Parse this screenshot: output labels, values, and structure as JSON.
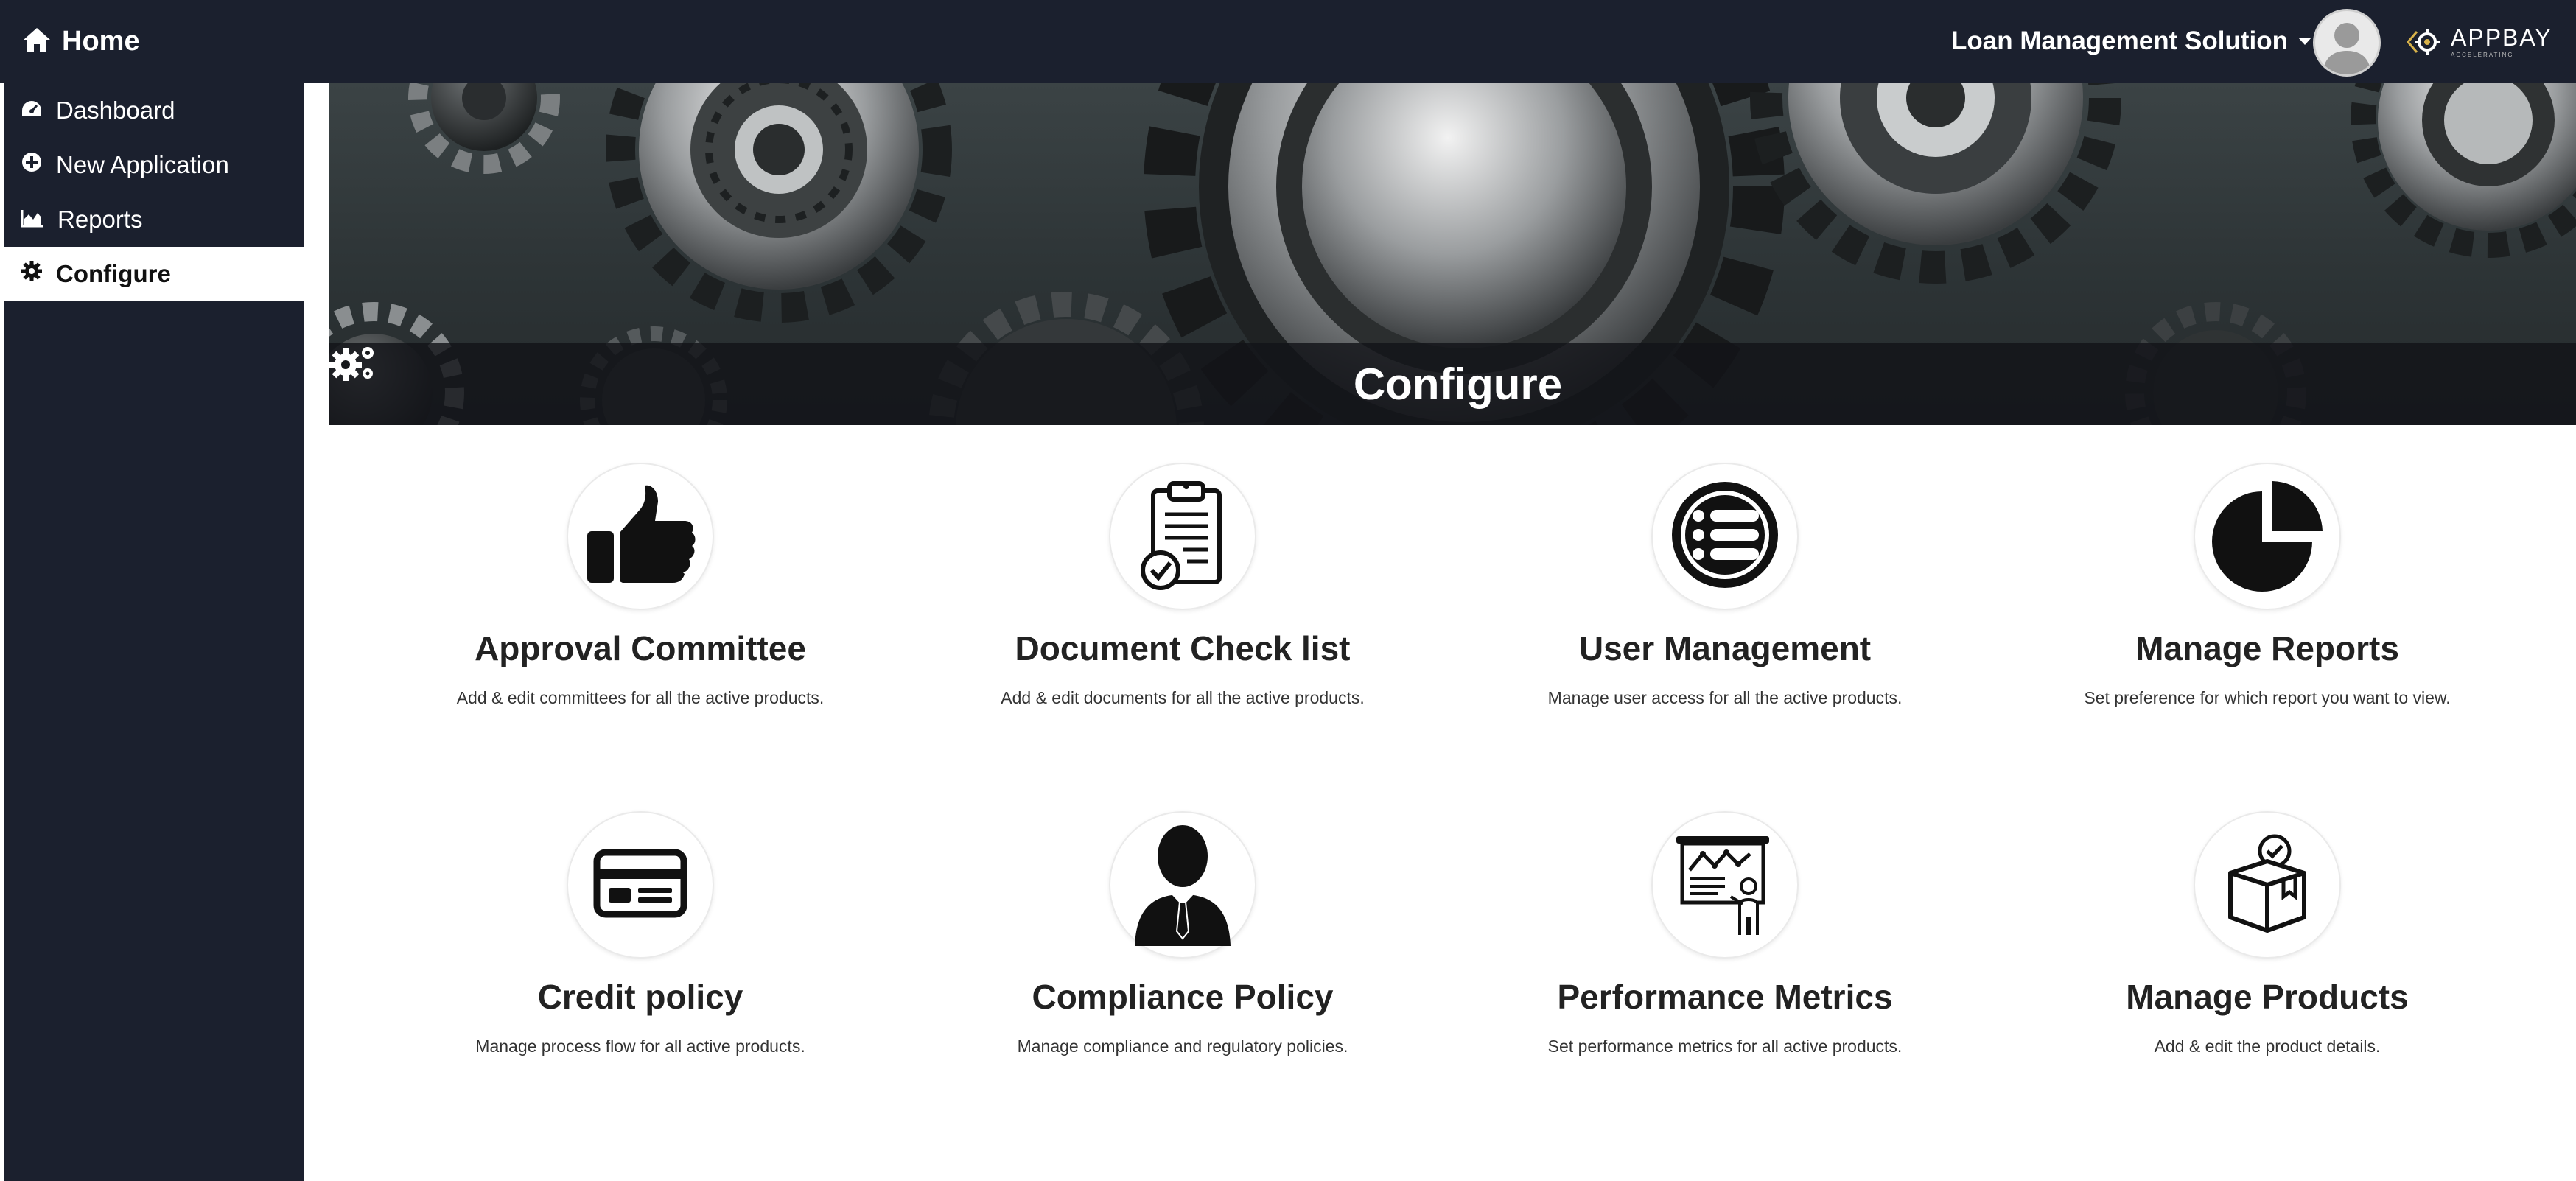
{
  "header": {
    "home_label": "Home",
    "product_label": "Loan Management Solution",
    "logo_text": "APPBAY",
    "logo_subtext": "ACCELERATING"
  },
  "sidebar": {
    "items": [
      {
        "label": "Dashboard",
        "icon": "dashboard-icon"
      },
      {
        "label": "New Application",
        "icon": "plus-circle-icon"
      },
      {
        "label": "Reports",
        "icon": "area-chart-icon"
      },
      {
        "label": "Configure",
        "icon": "gear-icon",
        "active": true
      }
    ]
  },
  "banner": {
    "title": "Configure",
    "icon": "gears-icon"
  },
  "cards": [
    {
      "title": "Approval Committee",
      "desc": "Add & edit committees for all the active products.",
      "icon": "thumbs-up-icon"
    },
    {
      "title": "Document Check list",
      "desc": "Add & edit documents for all the active products.",
      "icon": "clipboard-check-icon"
    },
    {
      "title": "User Management",
      "desc": "Manage user access for all the active products.",
      "icon": "list-circle-icon"
    },
    {
      "title": "Manage Reports",
      "desc": "Set preference for which report you want to view.",
      "icon": "pie-chart-icon"
    },
    {
      "title": "Credit policy",
      "desc": "Manage process flow for all active products.",
      "icon": "credit-card-icon"
    },
    {
      "title": "Compliance Policy",
      "desc": "Manage compliance and regulatory policies.",
      "icon": "person-suit-icon"
    },
    {
      "title": "Performance Metrics",
      "desc": "Set performance metrics for all active products.",
      "icon": "presentation-board-icon"
    },
    {
      "title": "Manage Products",
      "desc": "Add & edit the product details.",
      "icon": "box-check-icon"
    }
  ],
  "colors": {
    "nav_bg": "#1b202e",
    "active_bg": "#ffffff",
    "text_dark": "#222222"
  }
}
